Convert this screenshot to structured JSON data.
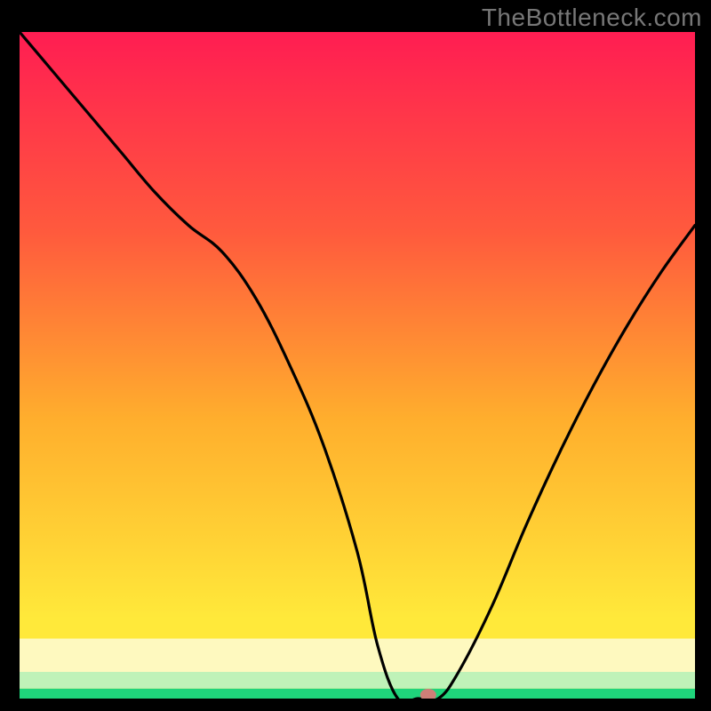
{
  "watermark": "TheBottleneck.com",
  "colors": {
    "bg": "#000000",
    "stroke": "#000000",
    "band_green": "#1fd47b",
    "band_mint": "#bff2b8",
    "band_cream": "#fef9bf",
    "grad_top": "#ff1d52",
    "grad_upper": "#ff5a3d",
    "grad_mid": "#ffae2d",
    "grad_lower": "#ffe93a",
    "marker": "#cf7f78"
  },
  "chart_data": {
    "type": "line",
    "title": "",
    "xlabel": "",
    "ylabel": "",
    "xlim": [
      0,
      100
    ],
    "ylim": [
      0,
      100
    ],
    "x": [
      0,
      5,
      10,
      15,
      20,
      25,
      30,
      35,
      40,
      45,
      50,
      53,
      56,
      59,
      62,
      65,
      70,
      75,
      80,
      85,
      90,
      95,
      100
    ],
    "values": [
      100,
      94,
      88,
      82,
      76,
      71,
      67,
      60,
      50,
      38,
      22,
      8,
      0,
      0,
      0,
      4,
      14,
      26,
      37,
      47,
      56,
      64,
      71
    ],
    "marker": {
      "x": 60.5,
      "y": 0
    },
    "bands": [
      {
        "from": 0,
        "to": 1.5,
        "color": "#1fd47b"
      },
      {
        "from": 1.5,
        "to": 4,
        "color": "#bff2b8"
      },
      {
        "from": 4,
        "to": 9,
        "color": "#fef9bf"
      }
    ]
  }
}
